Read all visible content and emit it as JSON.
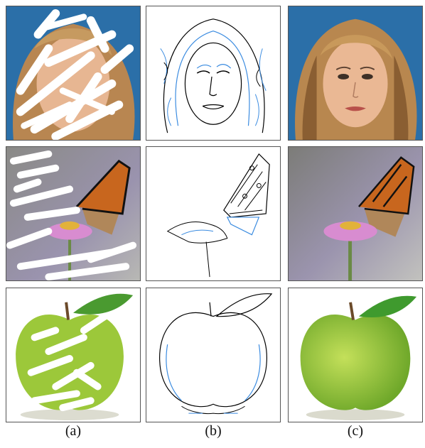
{
  "figure": {
    "captions": [
      "(a)",
      "(b)",
      "(c)"
    ],
    "columns": [
      "masked-input",
      "edge-map",
      "completed-output"
    ],
    "rows": [
      "face",
      "butterfly",
      "apple"
    ]
  }
}
